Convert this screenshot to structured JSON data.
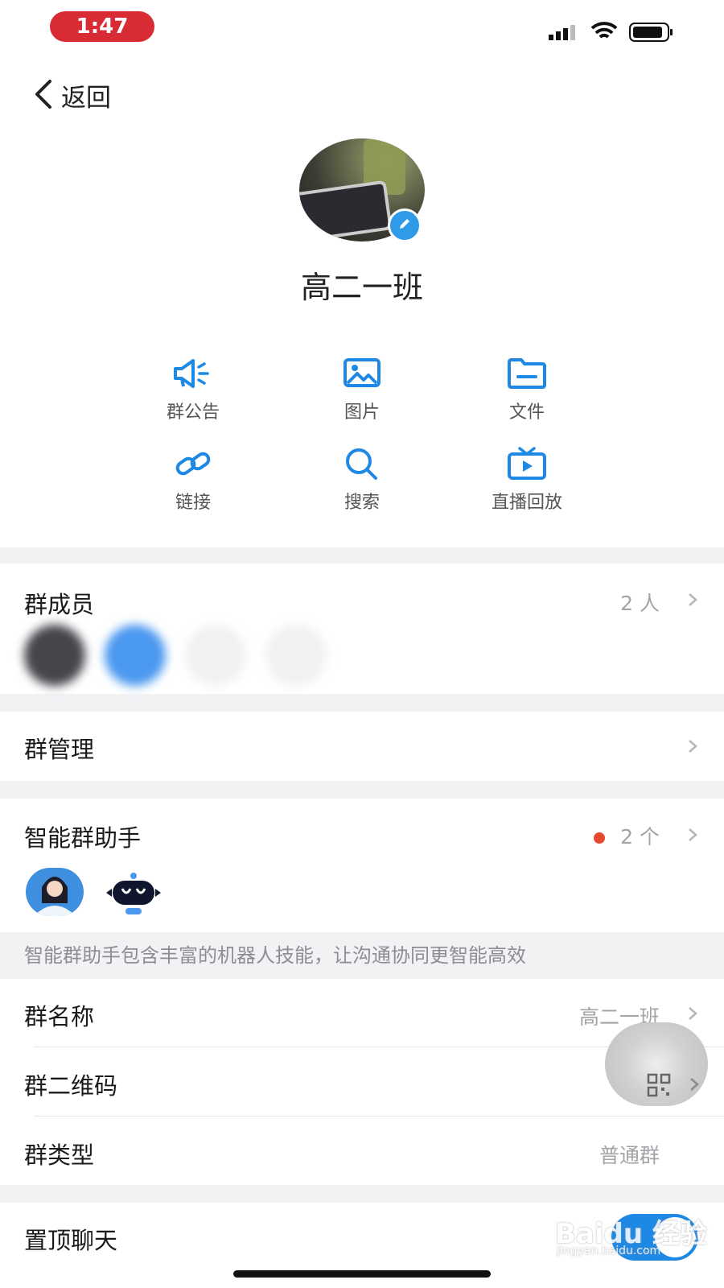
{
  "status_bar": {
    "time": "1:47"
  },
  "header": {
    "back_label": "返回"
  },
  "group": {
    "name": "高二一班"
  },
  "actions": [
    {
      "label": "群公告",
      "icon": "megaphone-icon"
    },
    {
      "label": "图片",
      "icon": "image-icon"
    },
    {
      "label": "文件",
      "icon": "folder-icon"
    },
    {
      "label": "链接",
      "icon": "link-icon"
    },
    {
      "label": "搜索",
      "icon": "search-icon"
    },
    {
      "label": "直播回放",
      "icon": "tv-icon"
    }
  ],
  "members": {
    "title": "群成员",
    "count": "2 人"
  },
  "management": {
    "title": "群管理"
  },
  "assistant": {
    "title": "智能群助手",
    "count": "2 个",
    "hint": "智能群助手包含丰富的机器人技能，让沟通协同更智能高效"
  },
  "info": {
    "name_label": "群名称",
    "name_value": "高二一班",
    "qr_label": "群二维码",
    "type_label": "群类型",
    "type_value": "普通群"
  },
  "pin": {
    "label": "置顶聊天",
    "enabled": true
  },
  "watermark": {
    "brand": "Baidu 经验",
    "url": "jingyan.baidu.com"
  },
  "colors": {
    "accent": "#1e88e5",
    "badge_red": "#e5492d",
    "time_pill": "#d82b34"
  }
}
